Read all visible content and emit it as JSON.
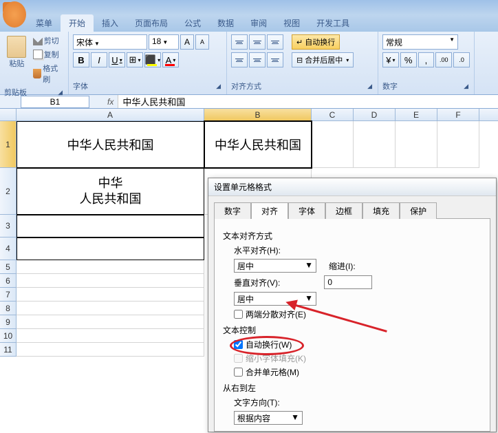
{
  "tabs": {
    "menu": "菜单",
    "home": "开始",
    "insert": "插入",
    "layout": "页面布局",
    "formula": "公式",
    "data": "数据",
    "review": "审阅",
    "view": "视图",
    "dev": "开发工具"
  },
  "clipboard": {
    "paste": "粘贴",
    "cut": "剪切",
    "copy": "复制",
    "brush": "格式刷",
    "label": "剪贴板"
  },
  "font": {
    "name": "宋体",
    "size": "18",
    "label": "字体"
  },
  "align": {
    "wrap": "自动换行",
    "merge": "合并后居中",
    "label": "对齐方式"
  },
  "number": {
    "format": "常规",
    "label": "数字"
  },
  "namebox": "B1",
  "formula": "中华人民共和国",
  "cols": {
    "A": "A",
    "B": "B",
    "C": "C",
    "D": "D",
    "E": "E",
    "F": "F"
  },
  "cells": {
    "A1": "中华人民共和国",
    "B1": "中华人民共和国",
    "A2_l1": "中华",
    "A2_l2": "人民共和国"
  },
  "dialog": {
    "title": "设置单元格格式",
    "tabs": {
      "number": "数字",
      "align": "对齐",
      "font": "字体",
      "border": "边框",
      "fill": "填充",
      "protect": "保护"
    },
    "text_align": "文本对齐方式",
    "halign": "水平对齐(H):",
    "halign_val": "居中",
    "indent": "缩进(I):",
    "indent_val": "0",
    "valign": "垂直对齐(V):",
    "valign_val": "居中",
    "justify": "两端分散对齐(E)",
    "text_ctrl": "文本控制",
    "wrap": "自动换行(W)",
    "shrink": "缩小字体填充(K)",
    "merge": "合并单元格(M)",
    "rtl": "从右到左",
    "dir": "文字方向(T):",
    "dir_val": "根据内容"
  }
}
